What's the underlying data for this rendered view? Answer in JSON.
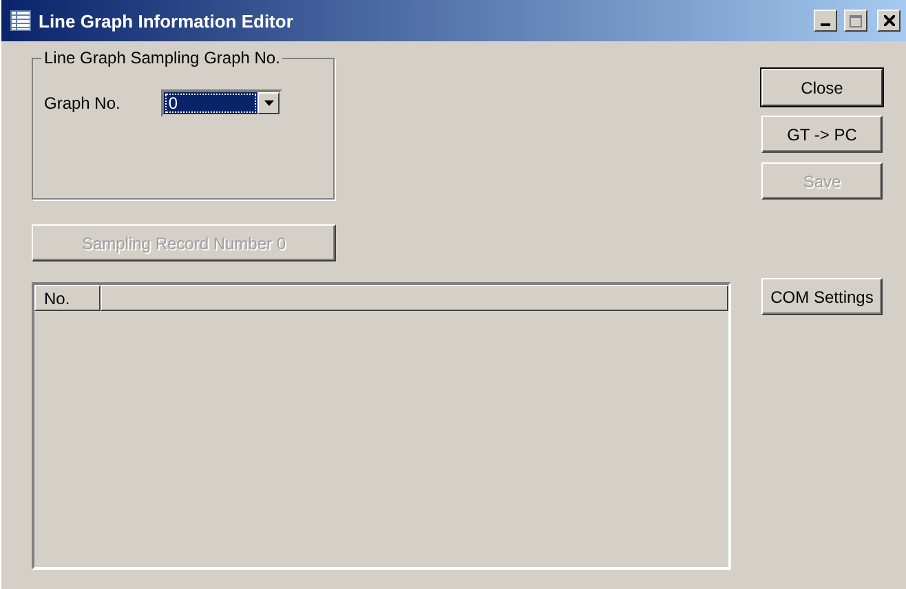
{
  "window": {
    "title": "Line Graph Information Editor"
  },
  "group": {
    "label": "Line Graph Sampling Graph No.",
    "field_label": "Graph No.",
    "combo": {
      "value": "0",
      "focused": true
    }
  },
  "record_button": {
    "label": "Sampling Record Number 0",
    "disabled": true
  },
  "table": {
    "columns": [
      "No."
    ]
  },
  "buttons": [
    {
      "label": "Close",
      "disabled": false,
      "default": true
    },
    {
      "label": "GT -> PC",
      "disabled": false,
      "default": false
    },
    {
      "label": "Save",
      "disabled": true,
      "default": false
    }
  ],
  "side_button": {
    "label": "COM Settings",
    "disabled": false
  }
}
